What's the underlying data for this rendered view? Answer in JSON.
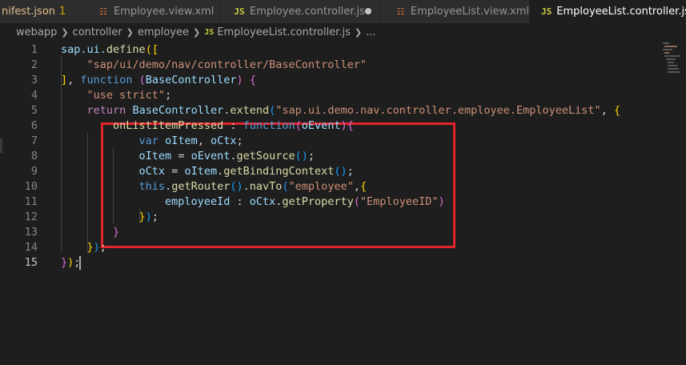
{
  "tabs": [
    {
      "label": "nifest.json",
      "badge": "1",
      "icon": "json-icon"
    },
    {
      "label": "Employee.view.xml",
      "icon": "rss-icon"
    },
    {
      "label": "Employee.controller.js",
      "icon": "js-icon",
      "modified": true
    },
    {
      "label": "EmployeeList.view.xml",
      "icon": "rss-icon"
    },
    {
      "label": "EmployeeList.controller.js",
      "icon": "js-icon",
      "active": true
    }
  ],
  "breadcrumb": {
    "parts": [
      "webapp",
      "controller",
      "employee",
      "EmployeeList.controller.js",
      "..."
    ],
    "js_icon": "JS"
  },
  "editor": {
    "lines": [
      {
        "n": "1",
        "tokens": [
          [
            "sap.ui.",
            "t-var"
          ],
          [
            "define",
            "t-fn"
          ],
          [
            "([",
            "b1"
          ]
        ]
      },
      {
        "n": "2",
        "tokens": [
          [
            "    ",
            ""
          ],
          [
            "\"sap/ui/demo/nav/controller/BaseController\"",
            "t-str"
          ]
        ]
      },
      {
        "n": "3",
        "tokens": [
          [
            "]",
            "b1"
          ],
          [
            ", ",
            ""
          ],
          [
            "function",
            "t-kw"
          ],
          [
            " ",
            ""
          ],
          [
            "(",
            "b2"
          ],
          [
            "BaseController",
            "t-var"
          ],
          [
            ")",
            "b2"
          ],
          [
            " ",
            ""
          ],
          [
            "{",
            "b2"
          ]
        ]
      },
      {
        "n": "4",
        "tokens": [
          [
            "    ",
            ""
          ],
          [
            "\"use strict\"",
            "t-str"
          ],
          [
            ";",
            ""
          ]
        ]
      },
      {
        "n": "5",
        "tokens": [
          [
            "    ",
            ""
          ],
          [
            "return",
            "t-ctl"
          ],
          [
            " ",
            ""
          ],
          [
            "BaseController",
            "t-var"
          ],
          [
            ".",
            ""
          ],
          [
            "extend",
            "t-fn"
          ],
          [
            "(",
            "b3"
          ],
          [
            "\"sap.ui.demo.nav.controller.employee.EmployeeList\"",
            "t-str"
          ],
          [
            ", ",
            ""
          ],
          [
            "{",
            "b1"
          ]
        ]
      },
      {
        "n": "6",
        "tokens": [
          [
            "        ",
            ""
          ],
          [
            "onListItemPressed",
            "t-fn"
          ],
          [
            " : ",
            ""
          ],
          [
            "function",
            "t-kw"
          ],
          [
            "(",
            "b2"
          ],
          [
            "oEvent",
            "t-var"
          ],
          [
            ")",
            "b2"
          ],
          [
            "{",
            "b2"
          ]
        ]
      },
      {
        "n": "7",
        "tokens": [
          [
            "            ",
            ""
          ],
          [
            "var",
            "t-kw"
          ],
          [
            " ",
            ""
          ],
          [
            "oItem",
            "t-var"
          ],
          [
            ", ",
            ""
          ],
          [
            "oCtx",
            "t-var"
          ],
          [
            ";",
            ""
          ]
        ]
      },
      {
        "n": "8",
        "tokens": [
          [
            "            ",
            ""
          ],
          [
            "oItem",
            "t-var"
          ],
          [
            " = ",
            ""
          ],
          [
            "oEvent",
            "t-var"
          ],
          [
            ".",
            ""
          ],
          [
            "getSource",
            "t-fn"
          ],
          [
            "()",
            "b3"
          ],
          [
            ";",
            ""
          ]
        ]
      },
      {
        "n": "9",
        "tokens": [
          [
            "            ",
            ""
          ],
          [
            "oCtx",
            "t-var"
          ],
          [
            " = ",
            ""
          ],
          [
            "oItem",
            "t-var"
          ],
          [
            ".",
            ""
          ],
          [
            "getBindingContext",
            "t-fn"
          ],
          [
            "()",
            "b3"
          ],
          [
            ";",
            ""
          ]
        ]
      },
      {
        "n": "10",
        "tokens": [
          [
            "            ",
            ""
          ],
          [
            "this",
            "t-kw"
          ],
          [
            ".",
            ""
          ],
          [
            "getRouter",
            "t-fn"
          ],
          [
            "()",
            "b3"
          ],
          [
            ".",
            ""
          ],
          [
            "navTo",
            "t-fn"
          ],
          [
            "(",
            "b3"
          ],
          [
            "\"employee\"",
            "t-str"
          ],
          [
            ",",
            ""
          ],
          [
            "{",
            "b1"
          ]
        ]
      },
      {
        "n": "11",
        "tokens": [
          [
            "                ",
            ""
          ],
          [
            "employeeId",
            "t-var"
          ],
          [
            " : ",
            ""
          ],
          [
            "oCtx",
            "t-var"
          ],
          [
            ".",
            ""
          ],
          [
            "getProperty",
            "t-fn"
          ],
          [
            "(",
            "b2"
          ],
          [
            "\"EmployeeID\"",
            "t-str"
          ],
          [
            ")",
            "b2"
          ]
        ]
      },
      {
        "n": "12",
        "tokens": [
          [
            "            ",
            ""
          ],
          [
            "}",
            "b1"
          ],
          [
            ")",
            "b3"
          ],
          [
            ";",
            ""
          ]
        ]
      },
      {
        "n": "13",
        "tokens": [
          [
            "        ",
            ""
          ],
          [
            "}",
            "b2"
          ]
        ]
      },
      {
        "n": "14",
        "tokens": [
          [
            "    ",
            ""
          ],
          [
            "}",
            "b1"
          ],
          [
            ")",
            "b3"
          ],
          [
            ";",
            ""
          ]
        ]
      },
      {
        "n": "15",
        "tokens": [
          [
            "}",
            "b2"
          ],
          [
            ")",
            "b1"
          ],
          [
            ";",
            ""
          ]
        ]
      }
    ],
    "current_line": "15"
  }
}
